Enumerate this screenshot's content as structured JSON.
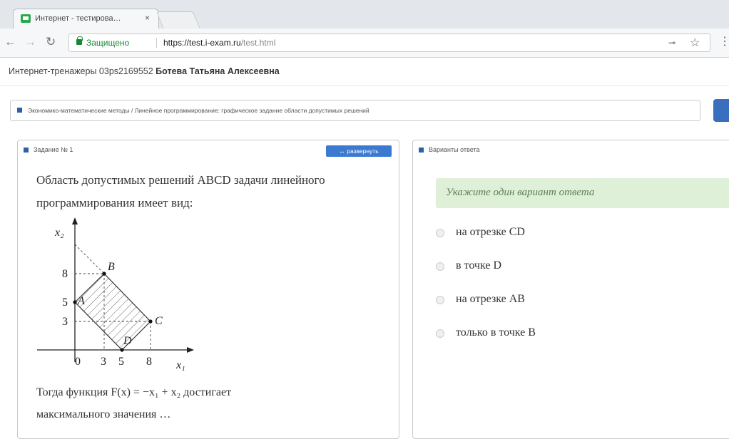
{
  "browser": {
    "tab_title": "Интернет - тестирова…",
    "tab_close": "×",
    "secure_label": "Защищено",
    "url_main": "https://test.i-exam.ru",
    "url_path": "/test.html"
  },
  "page": {
    "user_prefix": "Интернет-тренажеры 03ps2169552",
    "user_name": "Ботева Татьяна Алексеевна",
    "breadcrumb": "Экономико-математические методы / Линейное программирование: графическое задание области допустимых решений"
  },
  "task": {
    "header": "Задание № 1",
    "expand_label": "↔ развернуть",
    "text_line1": "Область допустимых решений ABCD задачи линейного",
    "text_line2": "программирования имеет вид:",
    "text_line3": "Тогда функция F(x) = −x₁ + x₂ достигает",
    "text_line4": "максимального значения …",
    "graph": {
      "y_axis": "x₂",
      "x_axis": "x₁",
      "y_ticks": [
        "8",
        "5",
        "3"
      ],
      "x_ticks": [
        "0",
        "3",
        "5",
        "8"
      ],
      "points": [
        "A",
        "B",
        "C",
        "D"
      ]
    }
  },
  "answers": {
    "header": "Варианты ответа",
    "hint": "Укажите один вариант ответа",
    "options": [
      "на отрезке CD",
      "в точке D",
      "на отрезке AB",
      "только в точке B"
    ]
  }
}
